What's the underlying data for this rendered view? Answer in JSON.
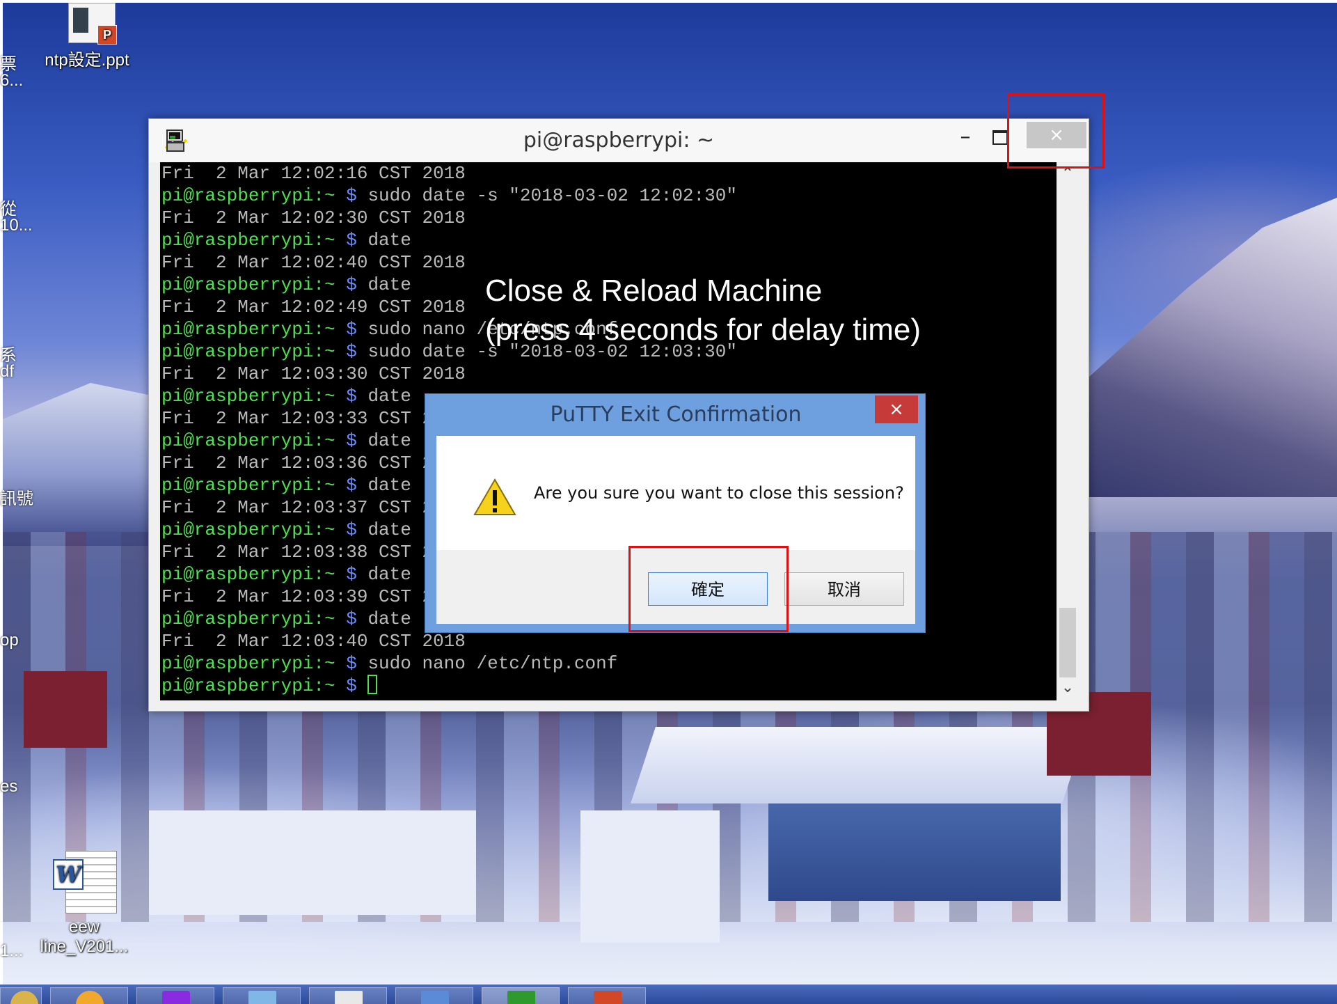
{
  "desktop": {
    "icons": {
      "ppt_label": "ntp設定.ppt",
      "word_label_line1": "eew",
      "word_label_line2": "line_V201..."
    },
    "edge_fragments": [
      "票",
      "6...",
      "從",
      "10...",
      "系",
      "df",
      "訊號",
      "op",
      "es",
      "1..."
    ]
  },
  "putty": {
    "title": "pi@raspberrypi: ~",
    "minimize_glyph": "–",
    "close_glyph": "×",
    "terminal_lines": [
      {
        "output": "Fri  2 Mar 12:02:16 CST 2018"
      },
      {
        "prompt": "pi@raspberrypi:~",
        "symbol": " $ ",
        "cmd": "sudo date -s \"2018-03-02 12:02:30\""
      },
      {
        "output": "Fri  2 Mar 12:02:30 CST 2018"
      },
      {
        "prompt": "pi@raspberrypi:~",
        "symbol": " $ ",
        "cmd": "date"
      },
      {
        "output": "Fri  2 Mar 12:02:40 CST 2018"
      },
      {
        "prompt": "pi@raspberrypi:~",
        "symbol": " $ ",
        "cmd": "date"
      },
      {
        "output": "Fri  2 Mar 12:02:49 CST 2018"
      },
      {
        "prompt": "pi@raspberrypi:~",
        "symbol": " $ ",
        "cmd": "sudo nano /etc/ntp.conf"
      },
      {
        "prompt": "pi@raspberrypi:~",
        "symbol": " $ ",
        "cmd": "sudo date -s \"2018-03-02 12:03:30\""
      },
      {
        "output": "Fri  2 Mar 12:03:30 CST 2018"
      },
      {
        "prompt": "pi@raspberrypi:~",
        "symbol": " $ ",
        "cmd": "date"
      },
      {
        "output": "Fri  2 Mar 12:03:33 CST 2018"
      },
      {
        "prompt": "pi@raspberrypi:~",
        "symbol": " $ ",
        "cmd": "date"
      },
      {
        "output": "Fri  2 Mar 12:03:36 CST 2018"
      },
      {
        "prompt": "pi@raspberrypi:~",
        "symbol": " $ ",
        "cmd": "date"
      },
      {
        "output": "Fri  2 Mar 12:03:37 CST 2018"
      },
      {
        "prompt": "pi@raspberrypi:~",
        "symbol": " $ ",
        "cmd": "date"
      },
      {
        "output": "Fri  2 Mar 12:03:38 CST 2018"
      },
      {
        "prompt": "pi@raspberrypi:~",
        "symbol": " $ ",
        "cmd": "date"
      },
      {
        "output": "Fri  2 Mar 12:03:39 CST 2018"
      },
      {
        "prompt": "pi@raspberrypi:~",
        "symbol": " $ ",
        "cmd": "date"
      },
      {
        "output": "Fri  2 Mar 12:03:40 CST 2018"
      },
      {
        "prompt": "pi@raspberrypi:~",
        "symbol": " $ ",
        "cmd": "sudo nano /etc/ntp.conf"
      },
      {
        "prompt": "pi@raspberrypi:~",
        "symbol": " $ ",
        "cmd": "",
        "cursor": true
      }
    ]
  },
  "annotation": {
    "line1": "Close & Reload Machine",
    "line2": "(press 4 seconds for delay time)"
  },
  "dialog": {
    "title": "PuTTY Exit Confirmation",
    "close_glyph": "×",
    "message": "Are you sure you want to close this session?",
    "ok_label": "確定",
    "cancel_label": "取消"
  },
  "colors": {
    "prompt_green": "#4ee04e",
    "dollar_blue": "#6a8bff",
    "terminal_bg": "#000000",
    "highlight_red": "#e01010",
    "dialog_frame": "#6ea0df"
  }
}
